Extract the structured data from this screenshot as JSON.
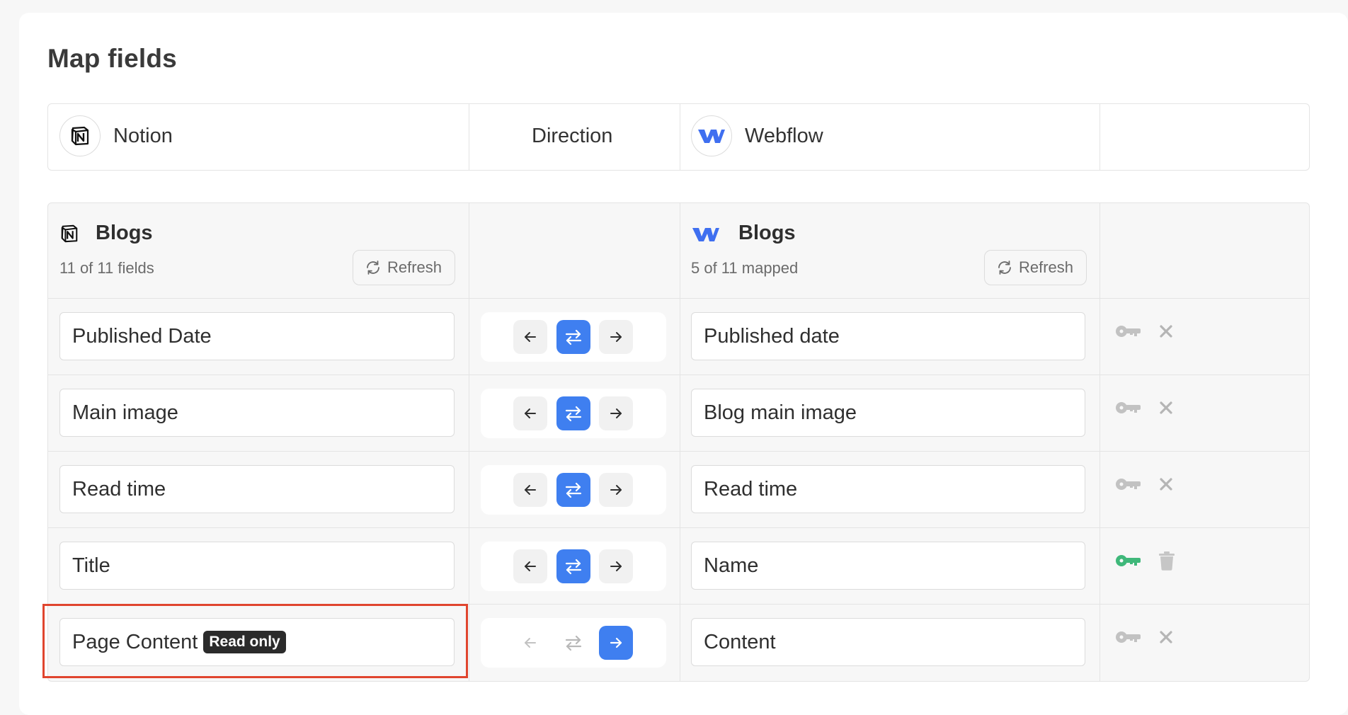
{
  "page": {
    "title": "Map fields"
  },
  "header": {
    "source_label": "Notion",
    "direction_label": "Direction",
    "target_label": "Webflow"
  },
  "source_collection": {
    "name": "Blogs",
    "fields_count": "11 of 11 fields",
    "refresh_label": "Refresh"
  },
  "target_collection": {
    "name": "Blogs",
    "mapped_count": "5 of 11 mapped",
    "refresh_label": "Refresh"
  },
  "rows": [
    {
      "source": "Published Date",
      "target": "Published date",
      "direction": "both",
      "badge": "",
      "key": "off",
      "action": "remove"
    },
    {
      "source": "Main image",
      "target": "Blog main image",
      "direction": "both",
      "badge": "",
      "key": "off",
      "action": "remove"
    },
    {
      "source": "Read time",
      "target": "Read time",
      "direction": "both",
      "badge": "",
      "key": "off",
      "action": "remove"
    },
    {
      "source": "Title",
      "target": "Name",
      "direction": "both",
      "badge": "",
      "key": "on",
      "action": "delete"
    },
    {
      "source": "Page Content",
      "target": "Content",
      "direction": "to-target",
      "badge": "Read only",
      "key": "off",
      "action": "remove"
    }
  ],
  "colors": {
    "accent": "#3f7ff0",
    "key_active": "#3fb87a",
    "highlight": "#e0452e",
    "webflow_brand": "#3f6ff0"
  },
  "icons": {
    "notion": "notion-logo-icon",
    "webflow": "webflow-logo-icon",
    "refresh": "refresh-icon",
    "arrow_left": "arrow-left-icon",
    "swap": "swap-arrows-icon",
    "arrow_right": "arrow-right-icon",
    "key": "key-icon",
    "close": "close-icon",
    "trash": "trash-icon"
  }
}
